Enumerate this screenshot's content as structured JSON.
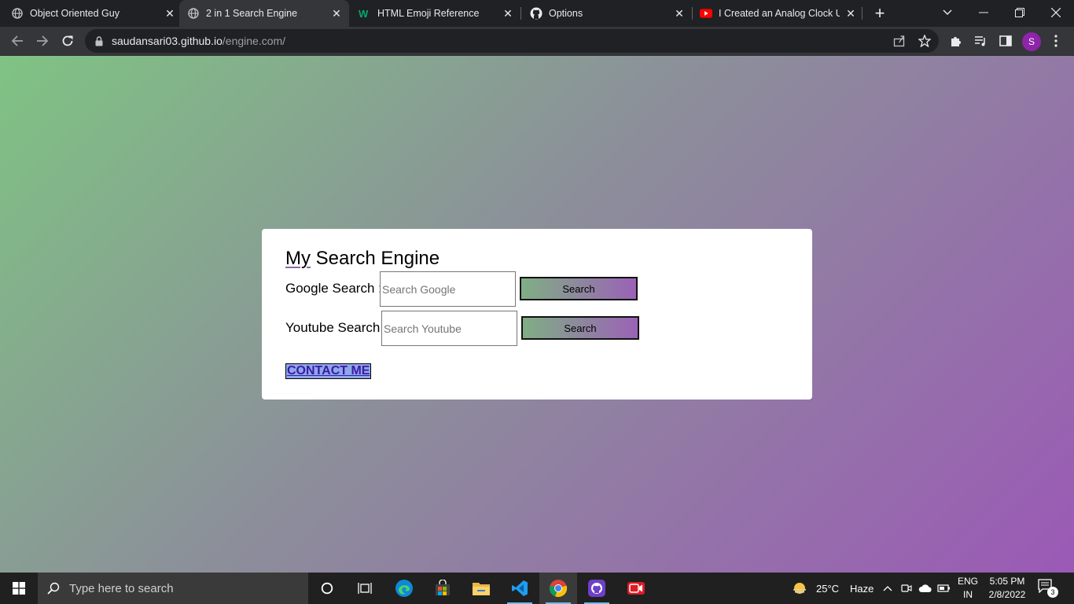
{
  "browser": {
    "tabs": [
      {
        "title": "Object Oriented Guy",
        "favicon": "globe-icon"
      },
      {
        "title": "2 in 1 Search Engine",
        "favicon": "globe-icon",
        "active": true
      },
      {
        "title": "HTML Emoji Reference",
        "favicon": "w3schools-icon"
      },
      {
        "title": "Options",
        "favicon": "github-icon"
      },
      {
        "title": "I Created an Analog Clock Us",
        "favicon": "youtube-icon"
      }
    ],
    "address": {
      "host": "saudansari03.github.io",
      "path": "/engine.com/"
    },
    "profile_initial": "S",
    "profile_color": "#8e24aa"
  },
  "page": {
    "heading": "My Search Engine",
    "heading_first": "My",
    "heading_rest": " Search Engine",
    "google": {
      "label": "Google Search :",
      "placeholder": "Search Google",
      "button": "Search"
    },
    "youtube": {
      "label": "Youtube Search:",
      "placeholder": "Search Youtube",
      "button": "Search"
    },
    "contact": "CONTACT ME",
    "gradient": [
      "#7fc383",
      "#9b59b6"
    ]
  },
  "taskbar": {
    "search_placeholder": "Type here to search",
    "weather_temp": "25°C",
    "weather_desc": "Haze",
    "lang_line1": "ENG",
    "lang_line2": "IN",
    "time": "5:05 PM",
    "date": "2/8/2022",
    "notification_count": "3"
  }
}
